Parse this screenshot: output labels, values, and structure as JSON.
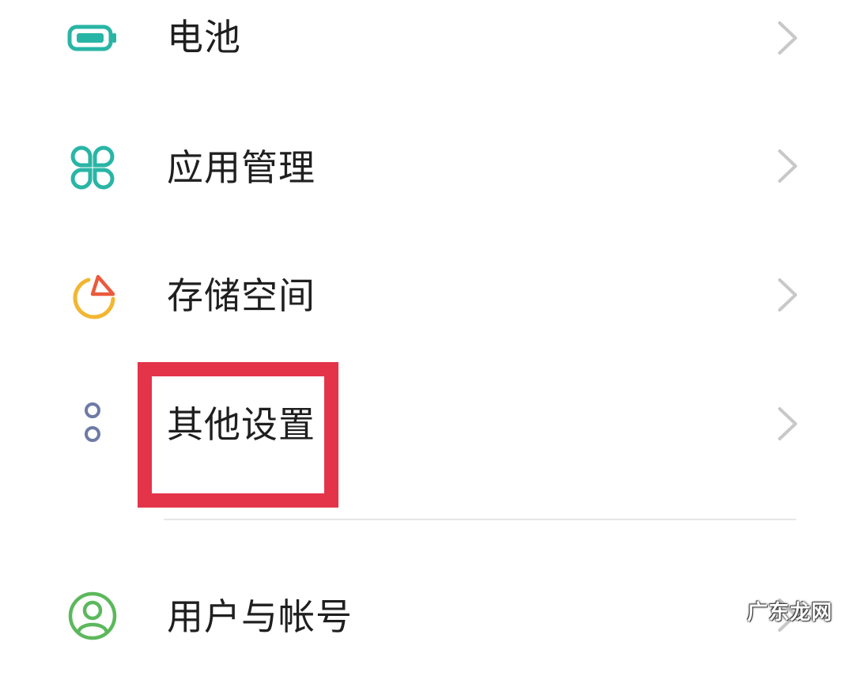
{
  "settings": {
    "items": [
      {
        "label": "电池",
        "icon": "battery-icon",
        "color": "#29b5a6"
      },
      {
        "label": "应用管理",
        "icon": "app-grid-icon",
        "color": "#29b5a6"
      },
      {
        "label": "存储空间",
        "icon": "storage-pie-icon",
        "color": "#f2b632",
        "accent": "#ea5a3c"
      },
      {
        "label": "其他设置",
        "icon": "other-settings-icon",
        "color": "#6e7aa6"
      },
      {
        "label": "用户与帐号",
        "icon": "user-account-icon",
        "color": "#5cb85c"
      }
    ]
  },
  "highlight": {
    "color": "#e3344a"
  },
  "watermark": {
    "text": "广东龙网"
  }
}
